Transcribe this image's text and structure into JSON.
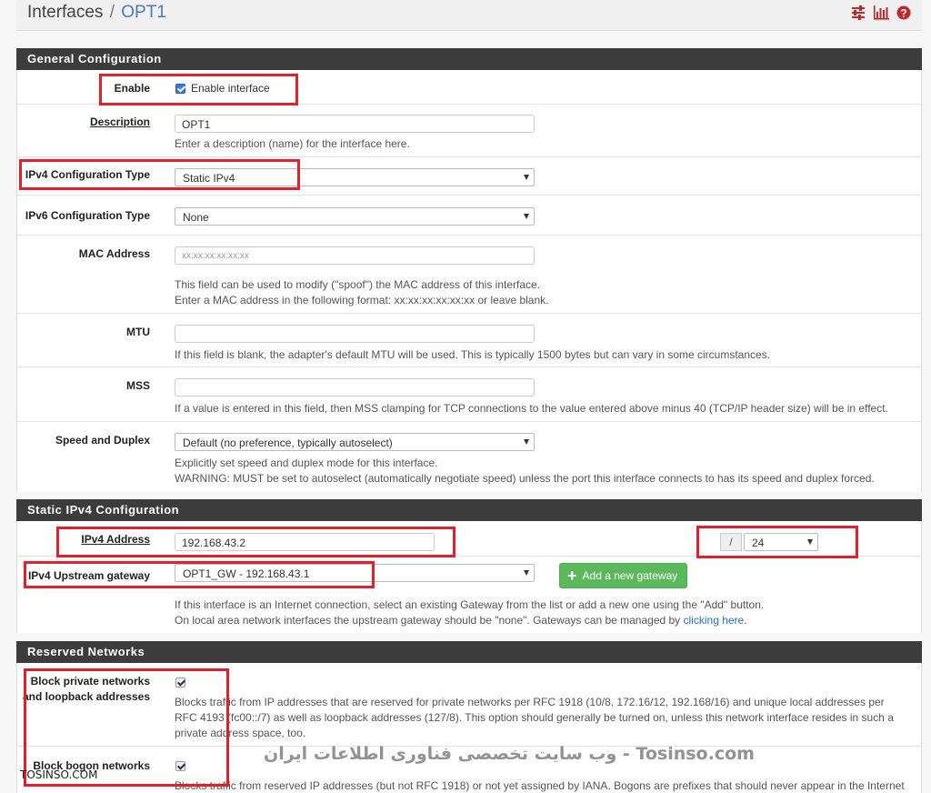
{
  "header": {
    "section": "Interfaces",
    "separator": "/",
    "current": "OPT1",
    "icons": [
      "sliders-icon",
      "bar-chart-icon",
      "help-icon"
    ]
  },
  "general": {
    "title": "General Configuration",
    "enable_label": "Enable",
    "enable_checkbox_label": "Enable interface",
    "enable_checked": true,
    "description_label": "Description",
    "description_value": "OPT1",
    "description_help": "Enter a description (name) for the interface here.",
    "ipv4_type_label": "IPv4 Configuration Type",
    "ipv4_type_value": "Static IPv4",
    "ipv6_type_label": "IPv6 Configuration Type",
    "ipv6_type_value": "None",
    "mac_label": "MAC Address",
    "mac_placeholder": "xx:xx:xx:xx:xx:xx",
    "mac_help_1": "This field can be used to modify (\"spoof\") the MAC address of this interface.",
    "mac_help_2": "Enter a MAC address in the following format: xx:xx:xx:xx:xx:xx or leave blank.",
    "mtu_label": "MTU",
    "mtu_help": "If this field is blank, the adapter's default MTU will be used. This is typically 1500 bytes but can vary in some circumstances.",
    "mss_label": "MSS",
    "mss_help": "If a value is entered in this field, then MSS clamping for TCP connections to the value entered above minus 40 (TCP/IP header size) will be in effect.",
    "speed_label": "Speed and Duplex",
    "speed_value": "Default (no preference, typically autoselect)",
    "speed_help_1": "Explicitly set speed and duplex mode for this interface.",
    "speed_help_2": "WARNING: MUST be set to autoselect (automatically negotiate speed) unless the port this interface connects to has its speed and duplex forced."
  },
  "static_ipv4": {
    "title": "Static IPv4 Configuration",
    "address_label": "IPv4 Address",
    "address_value": "192.168.43.2",
    "slash": "/",
    "cidr_value": "24",
    "gateway_label": "IPv4 Upstream gateway",
    "gateway_value": "OPT1_GW - 192.168.43.1",
    "add_gateway_button": "Add a new gateway",
    "gateway_help_1": "If this interface is an Internet connection, select an existing Gateway from the list or add a new one using the \"Add\" button.",
    "gateway_help_2": "On local area network interfaces the upstream gateway should be \"none\". Gateways can be managed by ",
    "gateway_help_link": "clicking here",
    "gateway_help_end": "."
  },
  "reserved": {
    "title": "Reserved Networks",
    "private_label_1": "Block private networks",
    "private_label_2": "and loopback addresses",
    "private_checked": true,
    "private_help_1": "Blocks traffic from IP addresses that are reserved for private networks per RFC 1918 (10/8, 172.16/12, 192.168/16) and unique local addresses per",
    "private_help_2": "RFC 4193 (fc00::/7) as well as loopback addresses (127/8). This option should generally be turned on, unless this network interface resides in such a",
    "private_help_3": "private address space, too.",
    "bogon_label": "Block bogon networks",
    "bogon_checked": true,
    "bogon_help_1": "Blocks traffic from reserved IP addresses (but not RFC 1918) or not yet assigned by IANA. Bogons are prefixes that should never appear in the Internet"
  },
  "watermark": {
    "center": "وب سایت تخصصی فناوری اطلاعات ایران - Tosinso.com",
    "left": "TOSINSO.COM"
  },
  "colors": {
    "accent": "#4a7cb8",
    "panel_header": "#3c3c3c",
    "highlight_red": "#e0202a",
    "button_green": "#5cb85c"
  }
}
